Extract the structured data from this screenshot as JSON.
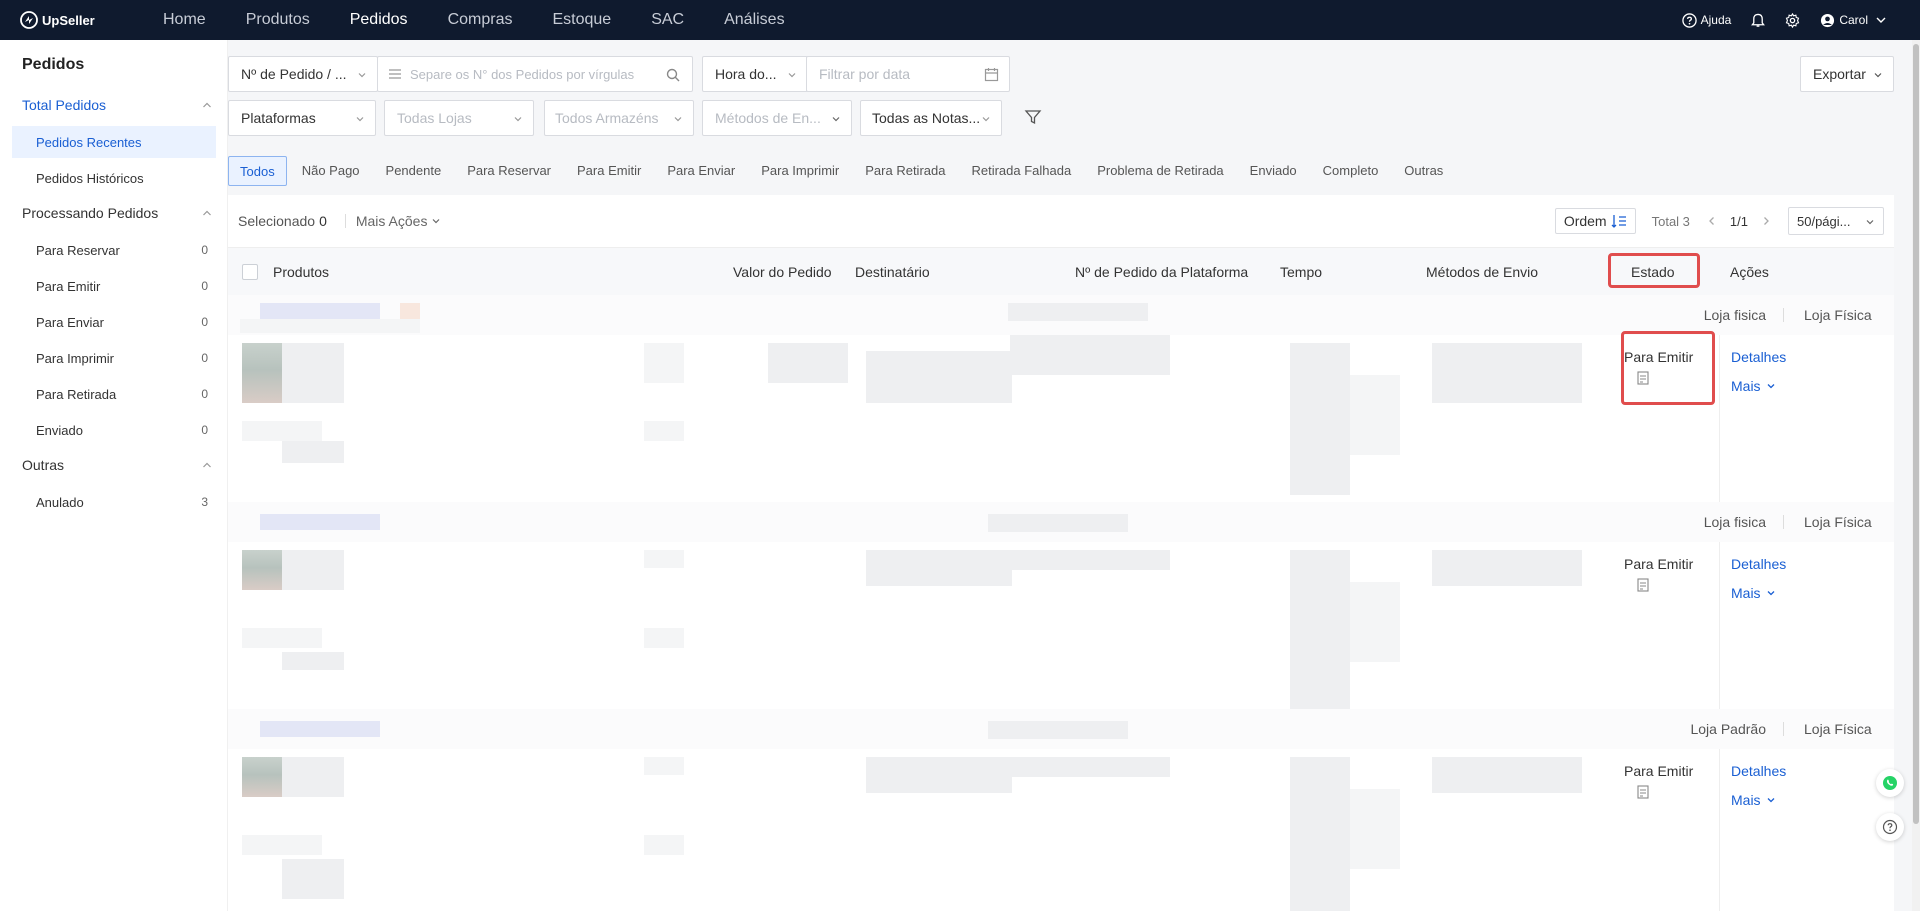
{
  "app": {
    "brand": "UpSeller"
  },
  "topnav": {
    "items": [
      "Home",
      "Produtos",
      "Pedidos",
      "Compras",
      "Estoque",
      "SAC",
      "Análises"
    ],
    "active": "Pedidos",
    "help_label": "Ajuda",
    "user_name": "Carol"
  },
  "sidebar": {
    "title": "Pedidos",
    "groups": [
      {
        "label": "Total Pedidos",
        "items": [
          {
            "label": "Pedidos Recentes",
            "active": true
          },
          {
            "label": "Pedidos Históricos"
          }
        ]
      },
      {
        "label": "Processando Pedidos",
        "items": [
          {
            "label": "Para Reservar",
            "count": "0"
          },
          {
            "label": "Para Emitir",
            "count": "0"
          },
          {
            "label": "Para Enviar",
            "count": "0"
          },
          {
            "label": "Para Imprimir",
            "count": "0"
          },
          {
            "label": "Para Retirada",
            "count": "0"
          },
          {
            "label": "Enviado",
            "count": "0"
          }
        ]
      },
      {
        "label": "Outras",
        "items": [
          {
            "label": "Anulado",
            "count": "3"
          }
        ]
      }
    ]
  },
  "filters": {
    "order_type": "Nº de Pedido / ...",
    "search_placeholder": "Separe os N° dos Pedidos por vírgulas",
    "time_select": "Hora do...",
    "date_placeholder": "Filtrar por data",
    "platforms": "Plataformas",
    "stores_placeholder": "Todas Lojas",
    "warehouses_placeholder": "Todos Armazéns",
    "shipping_placeholder": "Métodos de En...",
    "notes": "Todas as Notas...",
    "export_label": "Exportar"
  },
  "tabs": [
    "Todos",
    "Não Pago",
    "Pendente",
    "Para Reservar",
    "Para Emitir",
    "Para Enviar",
    "Para Imprimir",
    "Para Retirada",
    "Retirada Falhada",
    "Problema de Retirada",
    "Enviado",
    "Completo",
    "Outras"
  ],
  "toolbar": {
    "selected_label": "Selecionado",
    "selected_count": "0",
    "more_actions": "Mais Ações",
    "order_label": "Ordem",
    "total": "Total 3",
    "page": "1/1",
    "page_size": "50/pági..."
  },
  "table": {
    "headers": {
      "products": "Produtos",
      "value": "Valor do Pedido",
      "recipient": "Destinatário",
      "platform_order": "Nº de Pedido da Plataforma",
      "time": "Tempo",
      "shipping": "Métodos de Envio",
      "status": "Estado",
      "actions": "Ações"
    }
  },
  "orders": [
    {
      "store": "Loja fisica",
      "store_type": "Loja Física",
      "status": "Para Emitir",
      "details": "Detalhes",
      "more": "Mais"
    },
    {
      "store": "Loja fisica",
      "store_type": "Loja Física",
      "status": "Para Emitir",
      "details": "Detalhes",
      "more": "Mais"
    },
    {
      "store": "Loja Padrão",
      "store_type": "Loja Física",
      "status": "Para Emitir",
      "details": "Detalhes",
      "more": "Mais"
    }
  ],
  "colors": {
    "nav_bg": "#0f1a2e",
    "accent": "#1a5fd3",
    "highlight": "#e04d4d"
  },
  "icons": [
    "upseller-logo-icon",
    "help-icon",
    "bell-icon",
    "gear-icon",
    "user-icon",
    "search-icon",
    "list-icon",
    "calendar-icon",
    "filter-icon",
    "sort-icon",
    "document-icon",
    "whatsapp-icon",
    "question-icon"
  ]
}
